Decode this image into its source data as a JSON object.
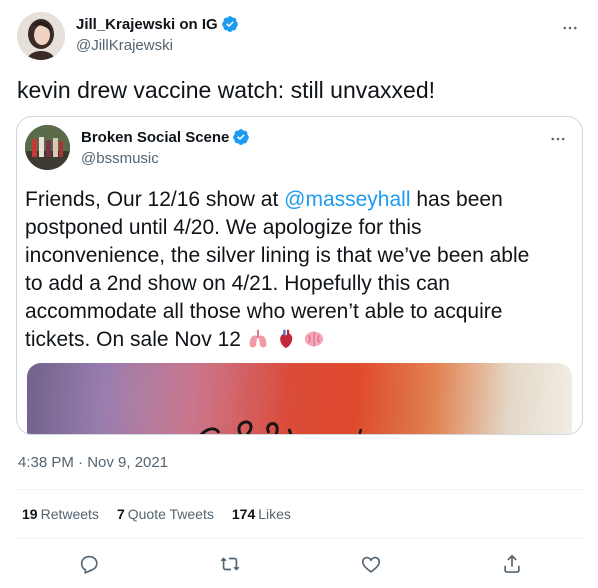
{
  "author": {
    "name": "Jill_Krajewski on IG",
    "handle": "@JillKrajewski",
    "verified": true,
    "avatar": "avatar-photo"
  },
  "tweet": {
    "text": "kevin drew vaccine watch: still unvaxxed!",
    "timestamp": "4:38 PM · Nov 9, 2021"
  },
  "quoted": {
    "name": "Broken Social Scene",
    "handle": "@bssmusic",
    "verified": true,
    "lines": [
      {
        "before": "Friends, Our 12/16 show at ",
        "mention": "@masseyhall",
        "after": " has been"
      },
      {
        "text": "postponed until 4/20. We apologize for this"
      },
      {
        "text": "inconvenience, the silver lining is that we’ve been able"
      },
      {
        "text": "to add a 2nd show on 4/21. Hopefully this can"
      },
      {
        "text": "accommodate all those who weren’t able to acquire"
      },
      {
        "text": "tickets. On sale Nov 12"
      }
    ],
    "emojis": [
      "lungs-emoji",
      "anatomical-heart-emoji",
      "brain-emoji"
    ]
  },
  "stats": {
    "retweets_count": "19",
    "retweets_label": "Retweets",
    "quotes_count": "7",
    "quotes_label": "Quote Tweets",
    "likes_count": "174",
    "likes_label": "Likes"
  },
  "actions": [
    "reply-icon",
    "retweet-icon",
    "like-icon",
    "share-icon"
  ],
  "colors": {
    "accent": "#1d9bf0",
    "text": "#0f1419",
    "muted": "#536471",
    "border": "#cfd9de"
  }
}
